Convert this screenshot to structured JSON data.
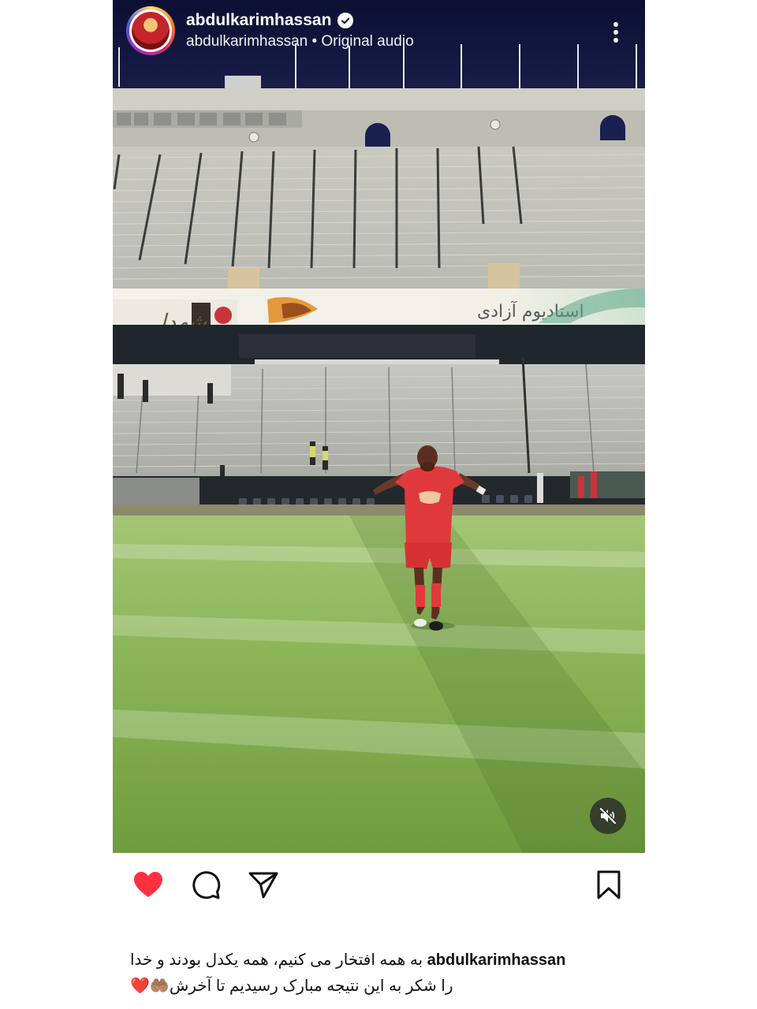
{
  "post": {
    "username": "abdulkarimhassan",
    "verified": true,
    "subline": "abdulkarimhassan • Original audio",
    "media": {
      "type": "reel",
      "signage": {
        "stadium_banner": "استادیوم آزادی",
        "left_banner": "شهدا"
      },
      "sound": "muted"
    },
    "icons": {
      "more": "more-vertical-icon",
      "mute": "speaker-muted-icon",
      "like": "heart-icon",
      "comment": "comment-icon",
      "share": "paper-plane-icon",
      "save": "bookmark-icon",
      "verified": "verified-badge-icon"
    },
    "liked": true,
    "colors": {
      "like_red": "#ff3040",
      "text": "#111111"
    },
    "caption": {
      "user": "abdulkarimhassan",
      "line1": "به همه افتخار می کنیم، همه یکدل بودند و خدا",
      "line2": "را شکر به این نتیجه مبارک رسیدیم تا آخرش",
      "emoji": "🤲🏽❤️"
    }
  }
}
